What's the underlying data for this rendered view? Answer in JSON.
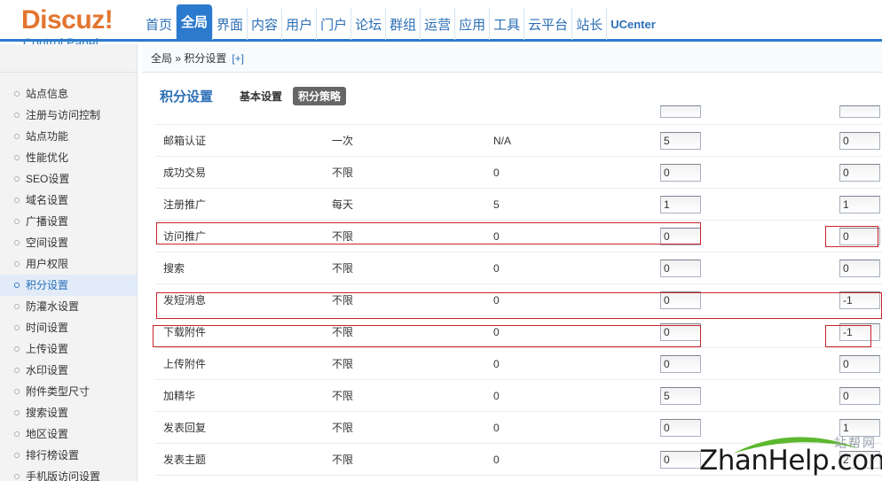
{
  "logo": {
    "brand": "Discuz!",
    "subtitle": "Control Panel"
  },
  "topnav": [
    "首页",
    "全局",
    "界面",
    "内容",
    "用户",
    "门户",
    "论坛",
    "群组",
    "运营",
    "应用",
    "工具",
    "云平台",
    "站长",
    "UCenter"
  ],
  "topnav_active": "全局",
  "breadcrumb": {
    "text": "全局 » 积分设置",
    "plus": "[+]"
  },
  "sidebar": {
    "items": [
      "站点信息",
      "注册与访问控制",
      "站点功能",
      "性能优化",
      "SEO设置",
      "域名设置",
      "广播设置",
      "空间设置",
      "用户权限",
      "积分设置",
      "防灌水设置",
      "时间设置",
      "上传设置",
      "水印设置",
      "附件类型尺寸",
      "搜索设置",
      "地区设置",
      "排行榜设置",
      "手机版访问设置"
    ],
    "active": "积分设置"
  },
  "main": {
    "title": "积分设置",
    "tabs": [
      {
        "label": "基本设置"
      },
      {
        "label": "积分策略"
      }
    ],
    "active_tab": "积分策略"
  },
  "rows": [
    {
      "name": "邮箱认证",
      "cycle": "一次",
      "times": "N/A",
      "v1": "5",
      "v2": "0"
    },
    {
      "name": "成功交易",
      "cycle": "不限",
      "times": "0",
      "v1": "0",
      "v2": "0"
    },
    {
      "name": "注册推广",
      "cycle": "每天",
      "times": "5",
      "v1": "1",
      "v2": "1"
    },
    {
      "name": "访问推广",
      "cycle": "不限",
      "times": "0",
      "v1": "0",
      "v2": "0"
    },
    {
      "name": "搜索",
      "cycle": "不限",
      "times": "0",
      "v1": "0",
      "v2": "0"
    },
    {
      "name": "发短消息",
      "cycle": "不限",
      "times": "0",
      "v1": "0",
      "v2": "-1"
    },
    {
      "name": "下载附件",
      "cycle": "不限",
      "times": "0",
      "v1": "0",
      "v2": "-1"
    },
    {
      "name": "上传附件",
      "cycle": "不限",
      "times": "0",
      "v1": "0",
      "v2": "0"
    },
    {
      "name": "加精华",
      "cycle": "不限",
      "times": "0",
      "v1": "5",
      "v2": "0"
    },
    {
      "name": "发表回复",
      "cycle": "不限",
      "times": "0",
      "v1": "0",
      "v2": "1"
    },
    {
      "name": "发表主题",
      "cycle": "不限",
      "times": "0",
      "v1": "0",
      "v2": "2"
    }
  ],
  "watermark": {
    "cn": "站帮网",
    "en": "ZhanHelp.com"
  },
  "colors": {
    "accent": "#2b7acd",
    "logo": "#e2762f",
    "highlight": "#c8232c",
    "watermark_arc": "#5cb82e"
  }
}
